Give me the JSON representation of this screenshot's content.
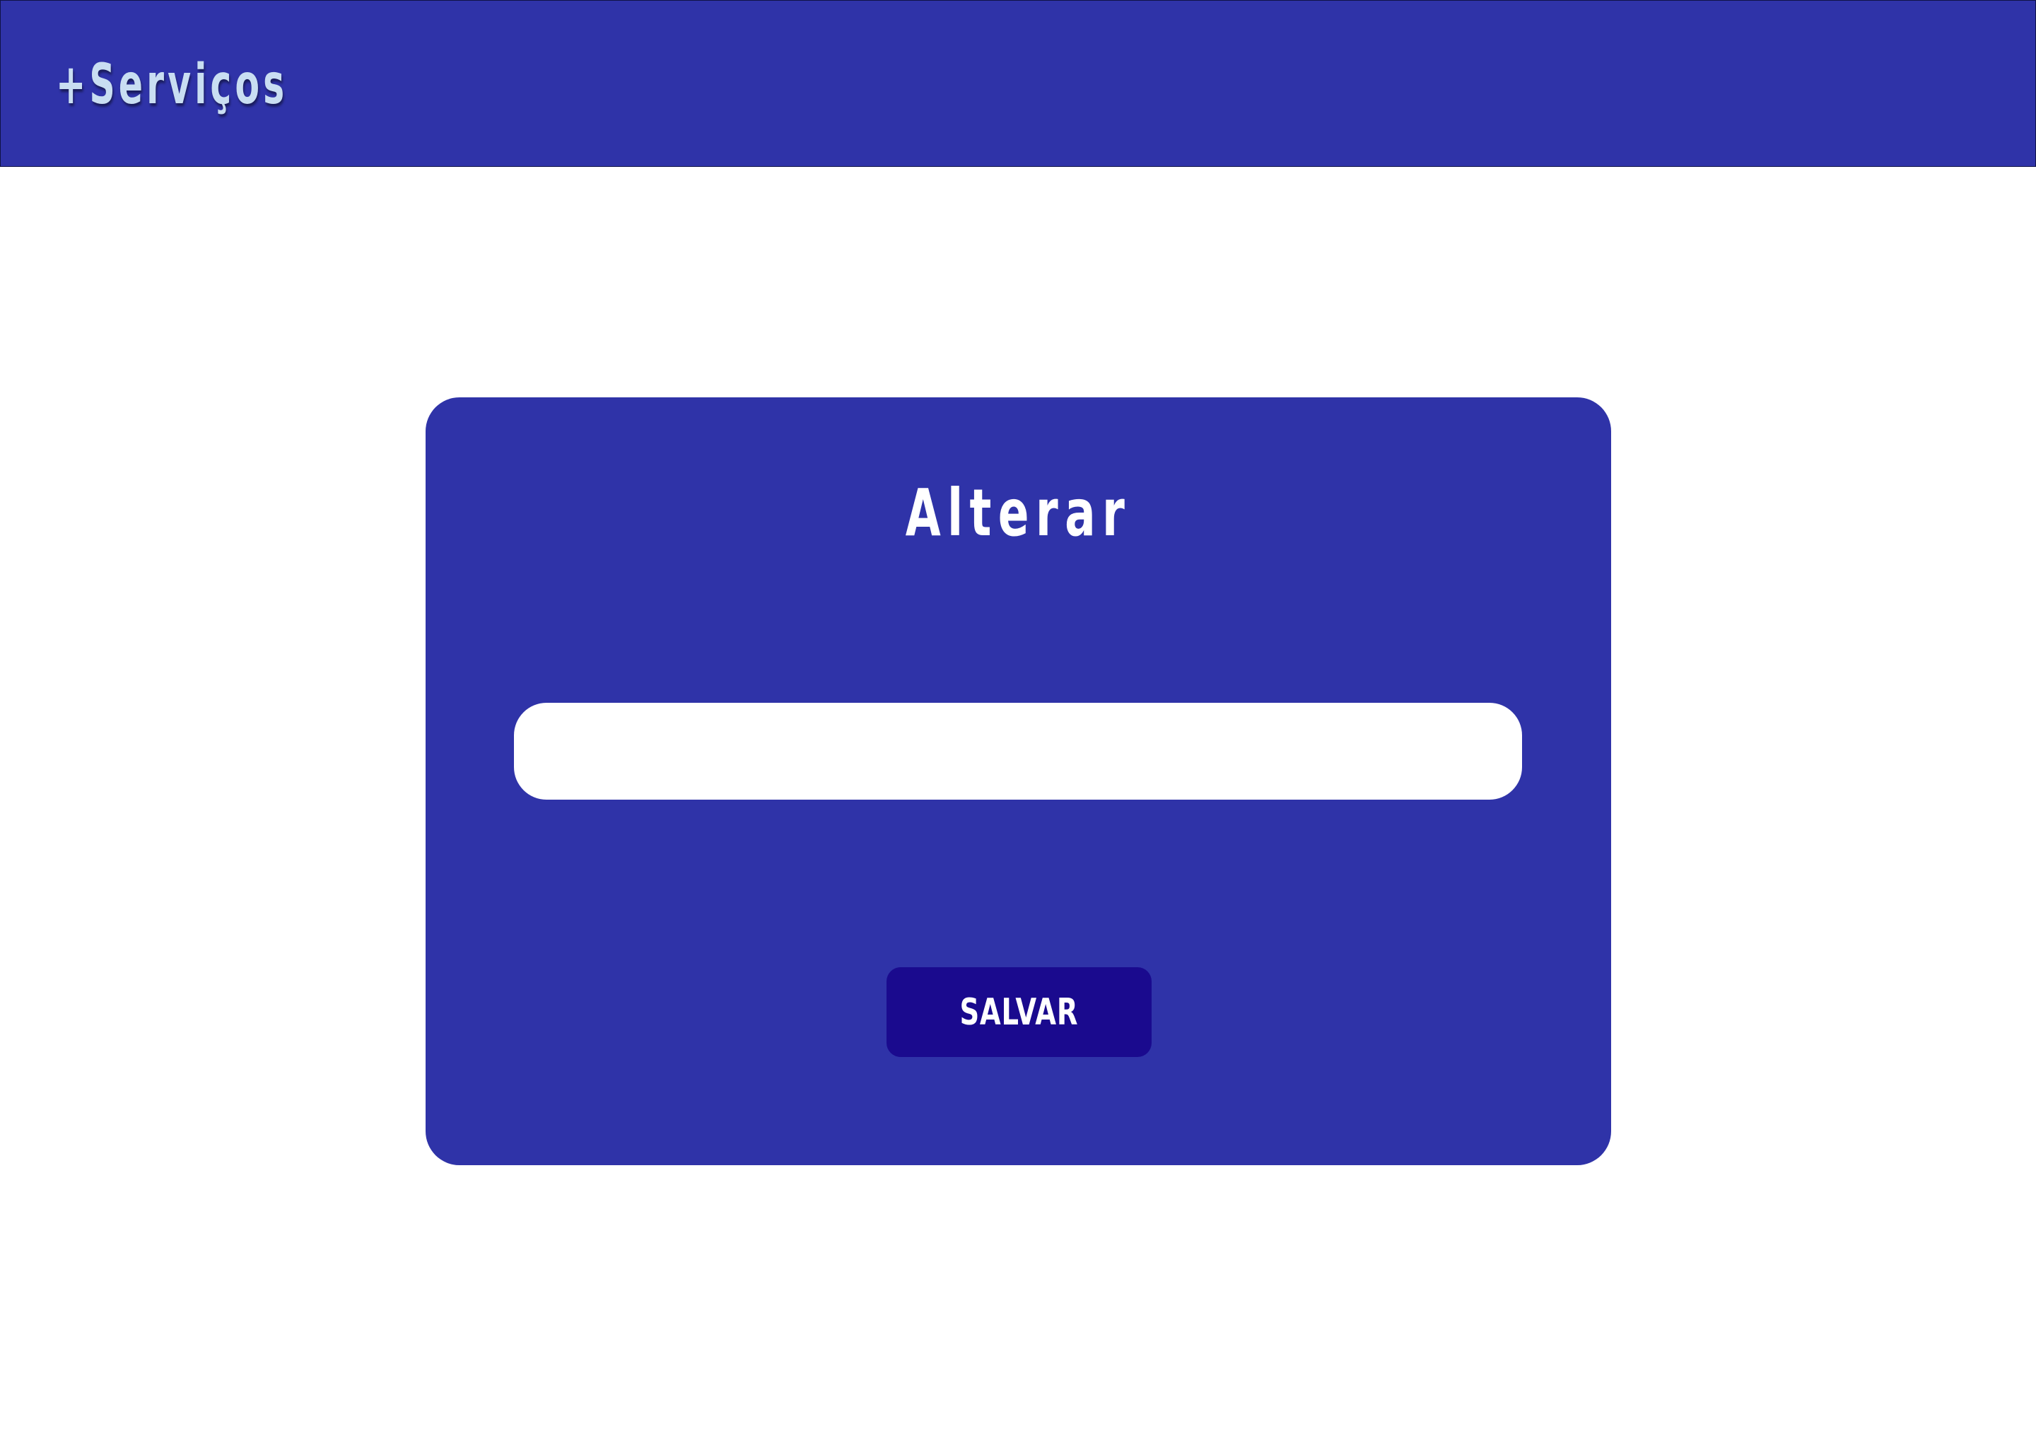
{
  "header": {
    "brand": "+Serviços",
    "background_color": "#2f33a8",
    "brand_color": "#c9def2"
  },
  "form": {
    "title": "Alterar",
    "input_value": "",
    "input_placeholder": "",
    "save_label": "SALVAR",
    "card_color": "#2f33a8",
    "button_color": "#1a0a8e"
  }
}
